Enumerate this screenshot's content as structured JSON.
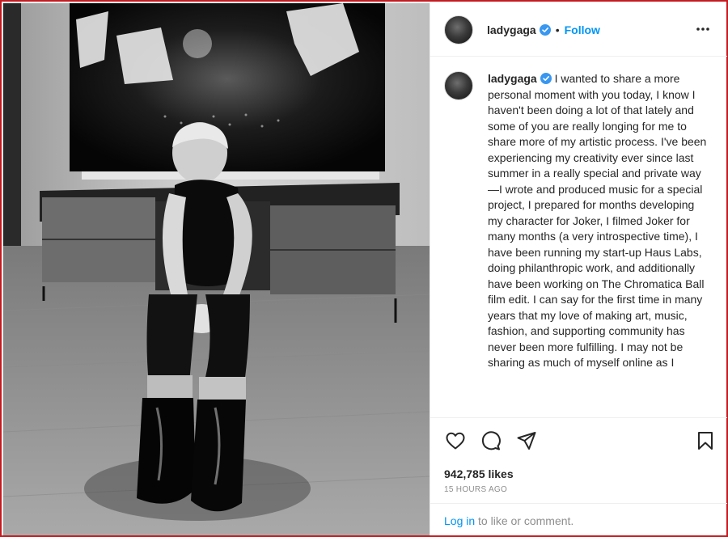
{
  "post": {
    "username": "ladygaga",
    "follow_label": "Follow",
    "separator": "•",
    "caption": "I wanted to share a more personal moment with you today, I know I haven't been doing a lot of that lately and some of you are really longing for me to share more of my artistic process. I've been experiencing my creativity ever since last summer in a really special and private way—I wrote and produced music for a special project, I prepared for months developing my character for Joker, I filmed Joker for many months (a very introspective time), I have been running my start-up Haus Labs, doing philanthropic work, and additionally have been working on The Chromatica Ball film edit. I can say for the first time in many years that my love of making art, music, fashion, and supporting community has never been more fulfilling. I may not be sharing as much of myself online as I",
    "likes": "942,785 likes",
    "time_ago": "15 HOURS AGO",
    "login_link": "Log in",
    "login_suffix": " to like or comment."
  },
  "icons": {
    "verified": "verified-badge-icon",
    "more": "more-options-icon",
    "like": "heart-icon",
    "comment": "comment-icon",
    "share": "share-icon",
    "save": "bookmark-icon"
  },
  "colors": {
    "accent": "#0095f6",
    "verified": "#3897f0",
    "text": "#262626",
    "muted": "#8e8e8e",
    "border": "#efefef",
    "window_frame": "#c41b20"
  }
}
